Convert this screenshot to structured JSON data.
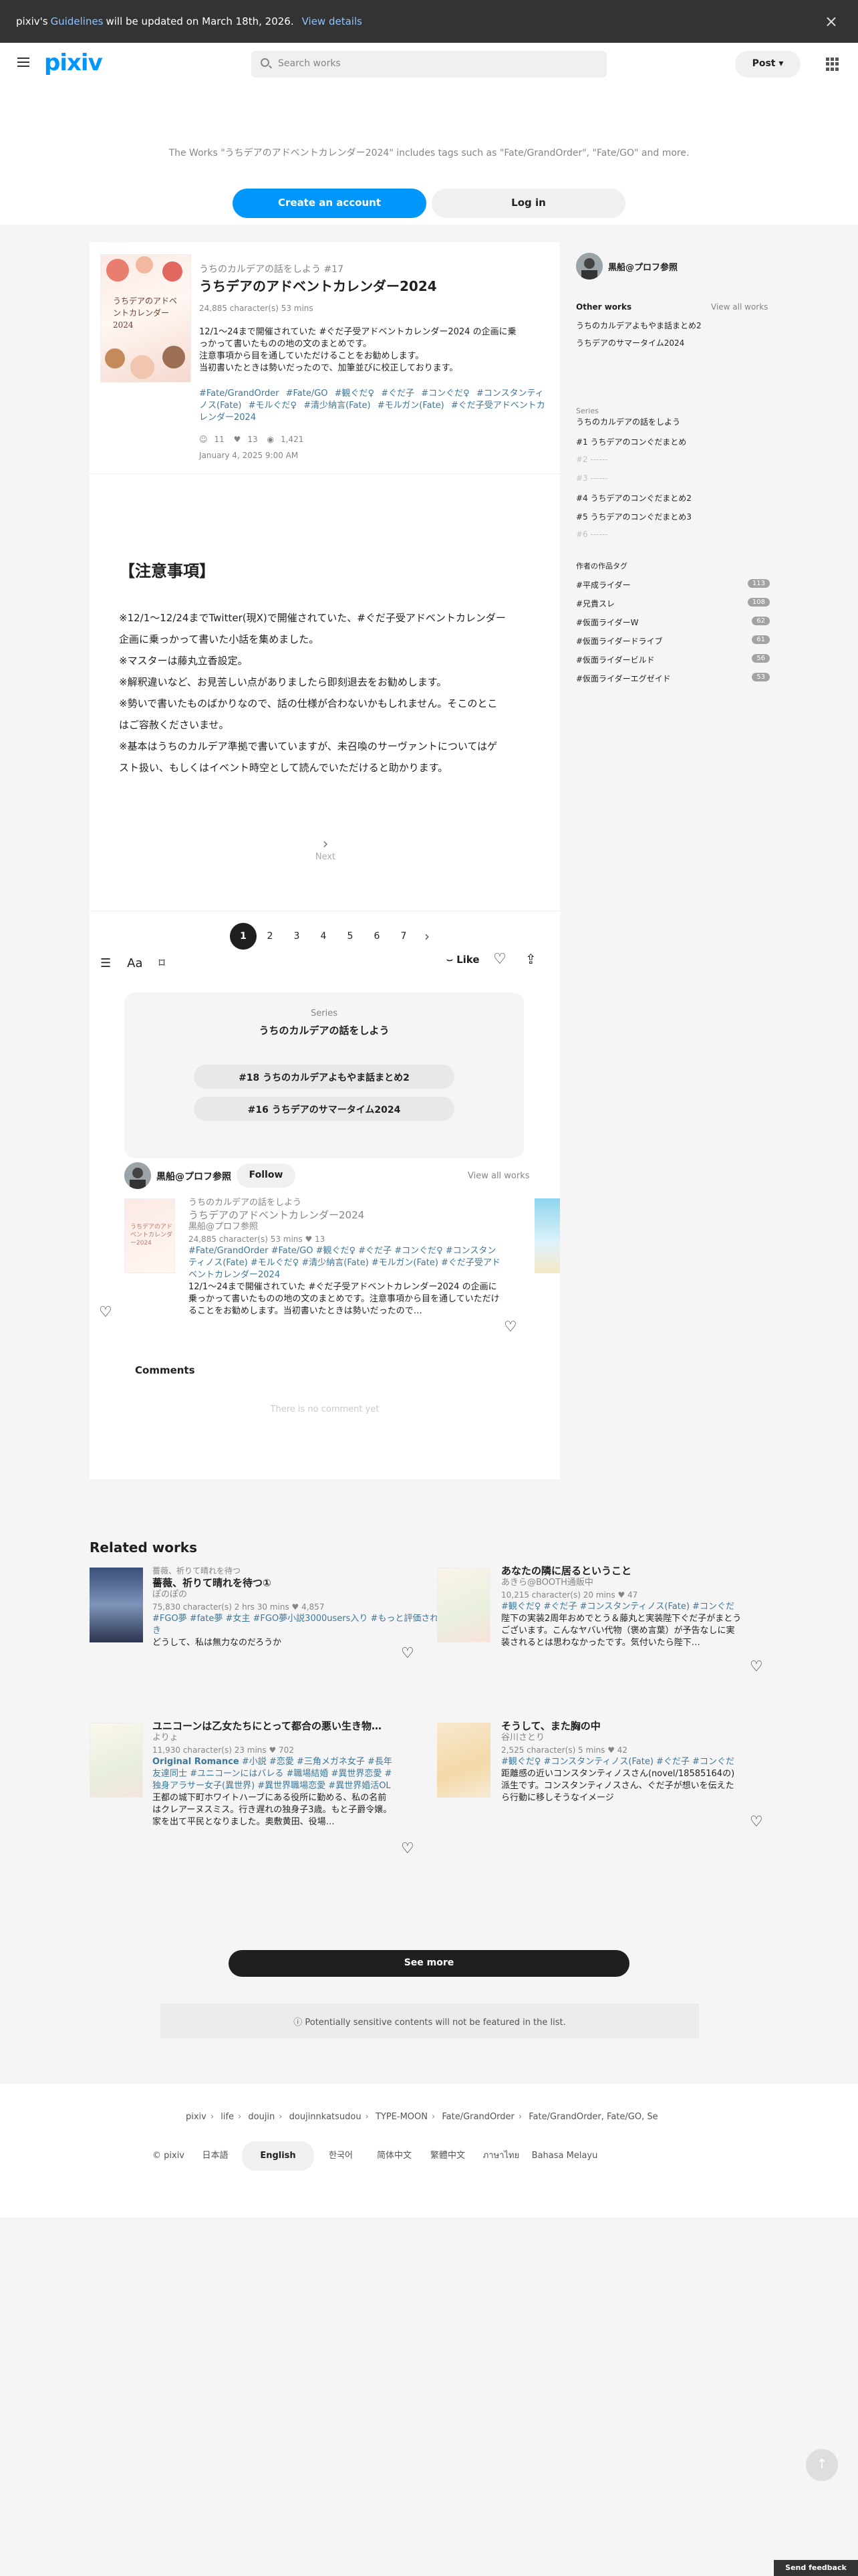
{
  "banner": {
    "prefix": "pixiv's ",
    "link": "Guidelines",
    "middle": " will be updated on March 18th, 2026.",
    "details": "View details",
    "close_icon": "×"
  },
  "header": {
    "logo": "pixiv",
    "search_placeholder": "Search works",
    "post_label": "Post ▾"
  },
  "intro": {
    "text": "The Works \"うちデアのアドベントカレンダー2024\" includes tags such as \"Fate/GrandOrder\", \"Fate/GO\" and more.",
    "create": "Create an account",
    "login": "Log in"
  },
  "work": {
    "cover_text": "うちデアのアドベントカレンダー2024",
    "series": "うちのカルデアの話をしよう #17",
    "title": "うちデアのアドベントカレンダー2024",
    "meta": "24,885 character(s)  53 mins",
    "caption": [
      "12/1〜24まで開催されていた #ぐだ子受アドベントカレンダー2024 の企画に乗",
      "っかって書いたものの地の文のまとめです。",
      "注意事項から目を通していただけることをお勧めします。",
      "当初書いたときは勢いだったので、加筆並びに校正しております。"
    ],
    "tags": [
      "#Fate/GrandOrder",
      "#Fate/GO",
      "#観ぐだ♀",
      "#ぐだ子",
      "#コンぐだ♀",
      "#コンスタンティノス(Fate)",
      "#モルぐだ♀",
      "#清少納言(Fate)",
      "#モルガン(Fate)",
      "#ぐだ子受アドベントカレンダー2024"
    ],
    "likes": "11",
    "bookmarks": "13",
    "views": "1,421",
    "date": "January 4, 2025 9:00 AM",
    "notice_head": "【注意事項】",
    "body": [
      "※12/1〜12/24までTwitter(現X)で開催されていた、#ぐだ子受アドベントカレンダー",
      "企画に乗っかって書いた小話を集めました。",
      "※マスターは藤丸立香設定。",
      "※解釈違いなど、お見苦しい点がありましたら即刻退去をお勧めします。",
      "※勢いで書いたものばかりなので、話の仕様が合わないかもしれません。そこのとこ",
      "はご容赦くださいませ。",
      "※基本はうちのカルデア準拠で書いていますが、未召喚のサーヴァントについてはゲ",
      "スト扱い、もしくはイベント時空として読んでいただけると助かります。"
    ],
    "next": "Next",
    "pages": [
      "1",
      "2",
      "3",
      "4",
      "5",
      "6",
      "7"
    ],
    "like_label": "Like"
  },
  "series_box": {
    "label": "Series",
    "title": "うちのカルデアの話をしよう",
    "next_item": "#18 うちのカルデアよもやま話まとめ2",
    "prev_item": "#16 うちデアのサマータイム2024"
  },
  "author": {
    "name": "黒船@プロフ参照",
    "follow": "Follow",
    "view_all": "View all works"
  },
  "author_work": {
    "series": "うちのカルデアの話をしよう",
    "title": "うちデアのアドベントカレンダー2024",
    "author": "黒船@プロフ参照",
    "stats": "24,885 character(s)  53 mins  ♥ 13",
    "tags": "#Fate/GrandOrder #Fate/GO #観ぐだ♀ #ぐだ子 #コンぐだ♀ #コンスタンティノス(Fate) #モルぐだ♀ #清少納言(Fate) #モルガン(Fate) #ぐだ子受アドベントカレンダー2024",
    "caption": "12/1〜24まで開催されていた #ぐだ子受アドベントカレンダー2024 の企画に乗っかって書いたものの地の文のまとめです。注意事項から目を通していただけることをお勧めします。当初書いたときは勢いだったので…"
  },
  "comments": {
    "heading": "Comments",
    "empty": "There is no comment yet"
  },
  "sidebar": {
    "name": "黒船@プロフ参照",
    "other_works": "Other works",
    "view_all": "View all works",
    "other": [
      "うちのカルデアよもやま話まとめ2",
      "うちデアのサマータイム2024"
    ],
    "series_label": "Series",
    "series_title": "うちのカルデアの話をしよう",
    "series_items": [
      "#1 うちデアのコンぐだまとめ",
      "#2 ------",
      "#3 ------",
      "#4 うちデアのコンぐだまとめ2",
      "#5 うちデアのコンぐだまとめ3",
      "#6 ------"
    ],
    "tags_label": "作者の作品タグ",
    "tags": [
      {
        "name": "#平成ライダー",
        "count": "113"
      },
      {
        "name": "#兄貴スレ",
        "count": "108"
      },
      {
        "name": "#仮面ライダーW",
        "count": "62"
      },
      {
        "name": "#仮面ライダードライブ",
        "count": "61"
      },
      {
        "name": "#仮面ライダービルド",
        "count": "56"
      },
      {
        "name": "#仮面ライダーエグゼイド",
        "count": "53"
      }
    ]
  },
  "related": {
    "heading": "Related works",
    "items": [
      {
        "series": "薔薇、祈りて晴れを待つ",
        "title": "薔薇、祈りて晴れを待つ①",
        "author": "ぽのぽの",
        "stats": "75,830 character(s)  2 hrs 30 mins  ♥ 4,857",
        "tags": "#FGO夢 #fate夢 #女主 #FGO夢小説3000users入り #もっと評価されるべき",
        "caption": "どうして、私は無力なのだろうか"
      },
      {
        "series": "",
        "title": "あなたの隣に居るということ",
        "author": "あきら@BOOTH通販中",
        "stats": "10,215 character(s)  20 mins  ♥ 47",
        "tags": "#観ぐだ♀ #ぐだ子 #コンスタンティノス(Fate) #コンぐだ",
        "caption": "陛下の実装2周年おめでとう＆藤丸と実装陛下ぐだ子がまとうございます。こんなヤバい代物（褒め言葉）が予告なしに実装されるとは思わなかったです。気付いたら陛下…"
      },
      {
        "series": "",
        "title": "ユニコーンは乙女たちにとって都合の悪い生き物…",
        "author": "よりょ",
        "stats": "11,930 character(s)  23 mins  ♥ 702",
        "tags_bold": "Original Romance",
        "tags": "#小説 #恋愛 #三角メガネ女子 #長年友達同士 #ユニコーンにはバレる #職場結婚 #異世界恋愛 #独身アラサー女子(異世界) #異世界職場恋愛 #異世界婚活OL",
        "caption": "王都の城下町ホワイトハーブにある役所に勤める、私の名前はクレアーヌスミス。行き遅れの独身子3歳。もと子爵令嬢。家を出て平民となりました。奥敷黄田、役場…"
      },
      {
        "series": "",
        "title": "そうして、また胸の中",
        "author": "谷川さとり",
        "stats": "2,525 character(s)  5 mins  ♥ 42",
        "tags": "#観ぐだ♀ #コンスタンティノス(Fate) #ぐだ子 #コンぐだ",
        "caption": "距離感の近いコンスタンティノスさん(novel/18585164の)派生です。コンスタンティノスさん、ぐだ子が想いを伝えたら行動に移しそうなイメージ"
      }
    ],
    "see_more": "See more",
    "sensitive": "Potentially sensitive contents will not be featured in the list."
  },
  "footer": {
    "crumbs": [
      "pixiv",
      "life",
      "doujin",
      "doujinnkatsudou",
      "TYPE-MOON",
      "Fate/GrandOrder",
      "Fate/GrandOrder, Fate/GO, Se"
    ],
    "copyright": "© pixiv",
    "langs": [
      "日本語",
      "English",
      "한국어",
      "简体中文",
      "繁體中文",
      "ภาษาไทย",
      "Bahasa Melayu"
    ]
  },
  "feedback": "Send feedback",
  "colors": {
    "accent": "#0096fa",
    "tag": "#3d7699",
    "dark": "#1f1f1f"
  }
}
